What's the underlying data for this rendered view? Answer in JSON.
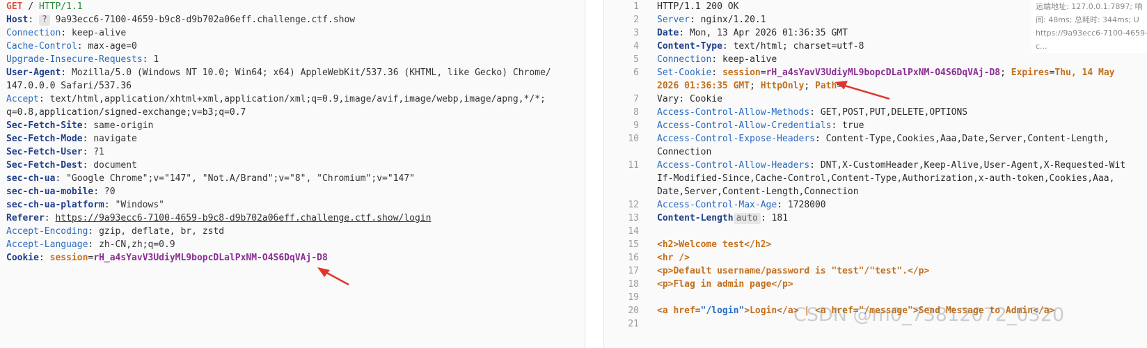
{
  "request": {
    "method": "GET",
    "path": "/",
    "version": "HTTP/1.1",
    "host_key": "Host",
    "host_badge": "?",
    "host_value": "9a93ecc6-7100-4659-b9c8-d9b702a06eff.challenge.ctf.show",
    "headers": [
      {
        "k": "Connection",
        "v": "keep-alive"
      },
      {
        "k": "Cache-Control",
        "v": "max-age=0"
      },
      {
        "k": "Upgrade-Insecure-Requests",
        "v": "1"
      },
      {
        "k": "User-Agent",
        "v": "Mozilla/5.0 (Windows NT 10.0; Win64; x64) AppleWebKit/537.36 (KHTML, like Gecko) Chrome/"
      },
      {
        "cont": "147.0.0.0 Safari/537.36"
      },
      {
        "k": "Accept",
        "v": "text/html,application/xhtml+xml,application/xml;q=0.9,image/avif,image/webp,image/apng,*/*;"
      },
      {
        "cont": "q=0.8,application/signed-exchange;v=b3;q=0.7"
      },
      {
        "k": "Sec-Fetch-Site",
        "v": "same-origin"
      },
      {
        "k": "Sec-Fetch-Mode",
        "v": "navigate"
      },
      {
        "k": "Sec-Fetch-User",
        "v": "?1"
      },
      {
        "k": "Sec-Fetch-Dest",
        "v": "document"
      },
      {
        "k": "sec-ch-ua",
        "v": "\"Google Chrome\";v=\"147\", \"Not.A/Brand\";v=\"8\", \"Chromium\";v=\"147\""
      },
      {
        "k": "sec-ch-ua-mobile",
        "v": "?0"
      },
      {
        "k": "sec-ch-ua-platform",
        "v": "\"Windows\""
      },
      {
        "k": "Referer",
        "v": "https://9a93ecc6-7100-4659-b9c8-d9b702a06eff.challenge.ctf.show/login"
      },
      {
        "k": "Accept-Encoding",
        "v": "gzip, deflate, br, zstd"
      },
      {
        "k": "Accept-Language",
        "v": "zh-CN,zh;q=0.9"
      }
    ],
    "cookie_key": "Cookie",
    "cookie_name": "session",
    "cookie_value": "rH_a4sYavV3UdiyML9bopcDLalPxNM-O4S6DqVAj-D8"
  },
  "response": {
    "line_numbers": [
      "1",
      "2",
      "3",
      "4",
      "5",
      "6",
      "",
      "7",
      "8",
      "9",
      "10",
      "",
      "11",
      "",
      "",
      "12",
      "13",
      "14",
      "15",
      "16",
      "17",
      "18",
      "19",
      "20",
      "21"
    ],
    "status": "HTTP/1.1 200 OK",
    "server_key": "Server",
    "server_val": "nginx/1.20.1",
    "date_key": "Date",
    "date_val": "Mon, 13 Apr 2026 01:36:35 GMT",
    "ctype_key": "Content-Type",
    "ctype_val": "text/html; charset=utf-8",
    "conn_key": "Connection",
    "conn_val": "keep-alive",
    "setcookie_key": "Set-Cookie",
    "sc_name": "session",
    "sc_value": "rH_a4sYavV3UdiyML9bopcDLalPxNM-O4S6DqVAj-D8",
    "sc_exp_key": "Expires",
    "sc_exp_val_1": "Thu, 14 May",
    "sc_exp_val_2": "2026 01:36:35 GMT",
    "sc_httponly": "HttpOnly",
    "sc_path_key": "Path",
    "sc_path_val": "/",
    "vary_key": "Vary",
    "vary_val": "Cookie",
    "acam_key": "Access-Control-Allow-Methods",
    "acam_val": "GET,POST,PUT,DELETE,OPTIONS",
    "acac_key": "Access-Control-Allow-Credentials",
    "acac_val": "true",
    "aceh_key": "Access-Control-Expose-Headers",
    "aceh_val": "Content-Type,Cookies,Aaa,Date,Server,Content-Length,",
    "aceh_cont": "Connection",
    "acah_key": "Access-Control-Allow-Headers",
    "acah_val": "DNT,X-CustomHeader,Keep-Alive,User-Agent,X-Requested-Wit",
    "acah_cont1": "If-Modified-Since,Cache-Control,Content-Type,Authorization,x-auth-token,Cookies,Aaa,",
    "acah_cont2": "Date,Server,Content-Length,Connection",
    "acma_key": "Access-Control-Max-Age",
    "acma_val": "1728000",
    "clen_key": "Content-Length",
    "clen_badge": "auto",
    "clen_val": "181",
    "body_h2": "<h2>Welcome test</h2>",
    "body_hr": "<hr />",
    "body_p1": "<p>Default username/password is \"test\"/\"test\".</p>",
    "body_p2": "<p>Flag in admin page</p>",
    "body_a_open": "<a href=",
    "body_a_href": "\"/login\"",
    "body_a_text": ">Login</a> | <a href=\"/message\">Send Message to Admin</a>"
  },
  "meta": {
    "line1": "远端地址: 127.0.0.1:7897; 响",
    "line2": "间: 48ms; 总耗时: 344ms; U",
    "line3": "https://9a93ecc6-7100-4659-",
    "line4": "c..."
  },
  "watermark": "CSDN @m0_73812072_0320",
  "colors": {
    "arrow": "#e0352b",
    "key": "#2a6bc1",
    "cookie_value": "#8a2e92",
    "cookie_name": "#c2701e"
  }
}
